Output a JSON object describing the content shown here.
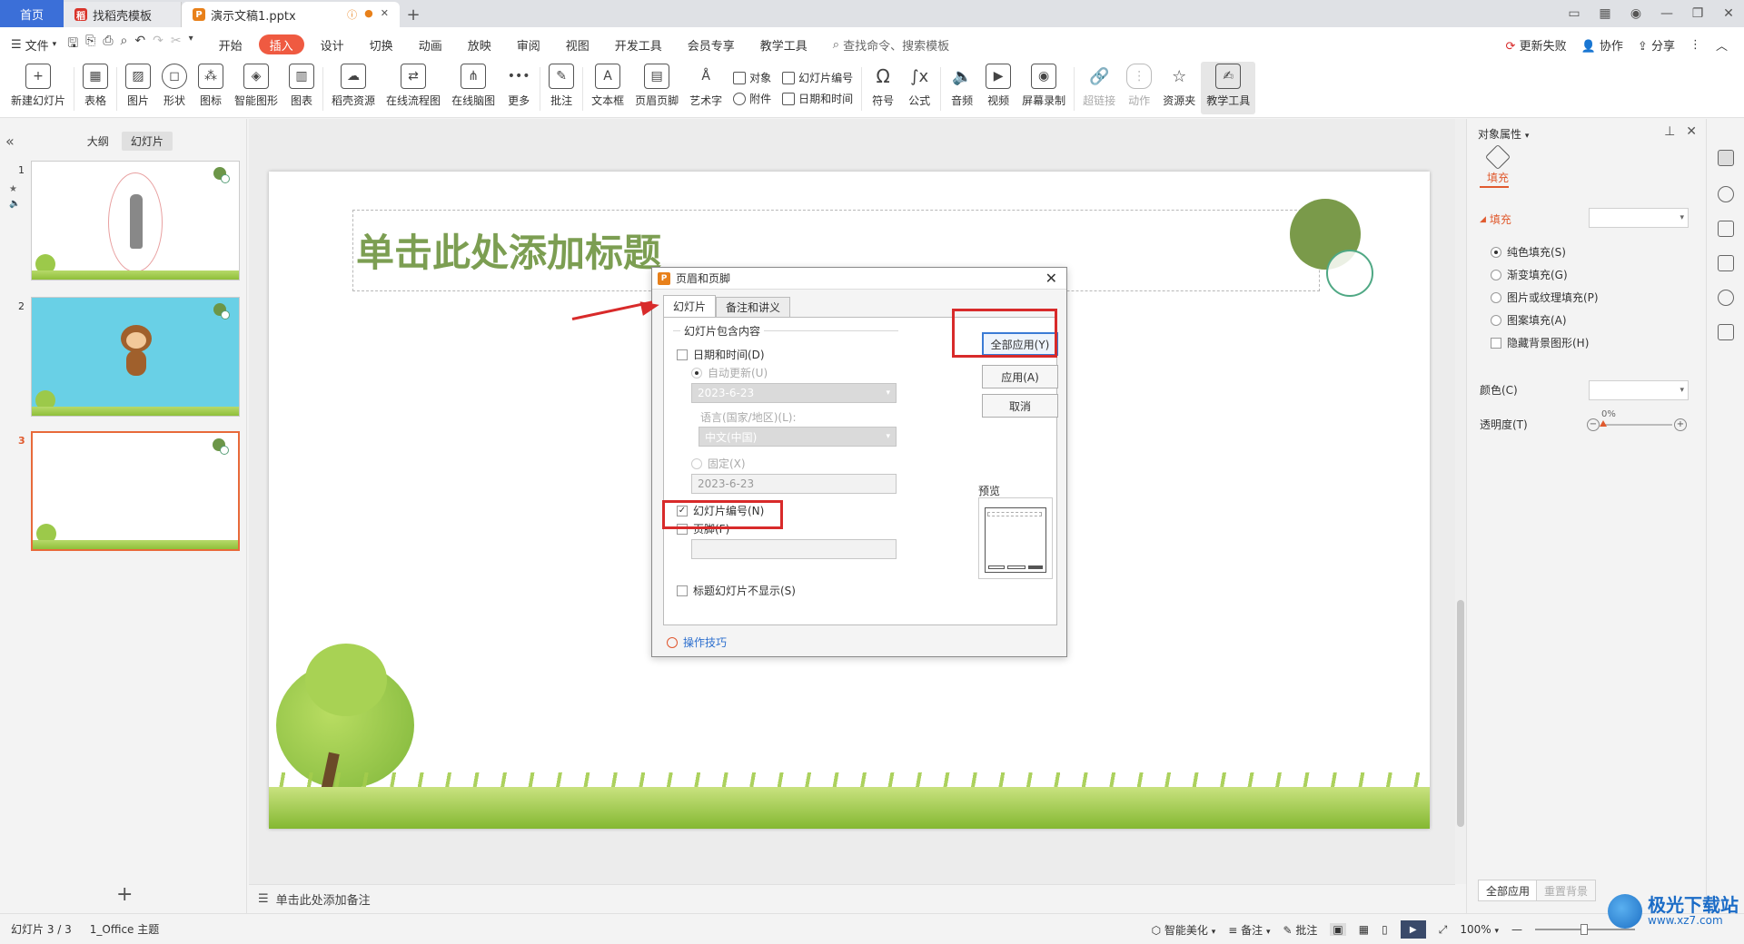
{
  "titlebar": {
    "home_tab": "首页",
    "tab_template": "找稻壳模板",
    "tab_doc": "演示文稿1.pptx",
    "new_tab": "+"
  },
  "menubar": {
    "file": "文件",
    "items": [
      "开始",
      "插入",
      "设计",
      "切换",
      "动画",
      "放映",
      "审阅",
      "视图",
      "开发工具",
      "会员专享",
      "教学工具"
    ],
    "active_item": "插入",
    "search": "查找命令、搜索模板",
    "update_failed": "更新失败",
    "collaborate": "协作",
    "share": "分享"
  },
  "ribbon": {
    "new_slide": "新建幻灯片",
    "table": "表格",
    "picture": "图片",
    "shape": "形状",
    "icon": "图标",
    "smart_graphic": "智能图形",
    "chart": "图表",
    "daoke": "稻壳资源",
    "flowchart": "在线流程图",
    "mindmap": "在线脑图",
    "more": "更多",
    "comment": "批注",
    "textbox": "文本框",
    "header_footer": "页眉页脚",
    "art_text": "艺术字",
    "object": "对象",
    "attachment": "附件",
    "slide_number": "幻灯片编号",
    "datetime": "日期和时间",
    "symbol": "符号",
    "formula": "公式",
    "audio": "音频",
    "video": "视频",
    "screen_record": "屏幕录制",
    "hyperlink": "超链接",
    "action": "动作",
    "resource": "资源夹",
    "teaching": "教学工具"
  },
  "leftpanel": {
    "outline_tab": "大纲",
    "slides_tab": "幻灯片",
    "slide_numbers": [
      "1",
      "2",
      "3"
    ],
    "add": "+"
  },
  "slide": {
    "title_placeholder": "单击此处添加标题"
  },
  "notes": {
    "placeholder": "单击此处添加备注"
  },
  "dialog": {
    "title": "页眉和页脚",
    "tab_slide": "幻灯片",
    "tab_notes": "备注和讲义",
    "group_label": "幻灯片包含内容",
    "date_time": "日期和时间(D)",
    "auto_update": "自动更新(U)",
    "auto_date": "2023-6-23",
    "language_label": "语言(国家/地区)(L):",
    "language": "中文(中国)",
    "fixed": "固定(X)",
    "fixed_date": "2023-6-23",
    "slide_number": "幻灯片编号(N)",
    "slide_number_checked": true,
    "footer": "页脚(F)",
    "footer_value": "",
    "hide_on_title": "标题幻灯片不显示(S)",
    "apply_all": "全部应用(Y)",
    "apply": "应用(A)",
    "cancel": "取消",
    "preview": "预览",
    "help": "操作技巧"
  },
  "rightpanel": {
    "title": "对象属性",
    "fill_tab": "填充",
    "fill_section": "填充",
    "options": [
      "纯色填充(S)",
      "渐变填充(G)",
      "图片或纹理填充(P)",
      "图案填充(A)"
    ],
    "selected_option": "纯色填充(S)",
    "hide_bg": "隐藏背景图形(H)",
    "color_label": "颜色(C)",
    "transparency_label": "透明度(T)",
    "transparency_value": "0%",
    "apply_all": "全部应用",
    "reset_bg": "重置背景"
  },
  "statusbar": {
    "slide_info": "幻灯片 3 / 3",
    "theme": "1_Office 主题",
    "smart_beautify": "智能美化",
    "notes": "备注",
    "comments": "批注",
    "zoom": "100%"
  },
  "watermark": {
    "name": "极光下载站",
    "url": "www.xz7.com"
  },
  "colors": {
    "accent": "#ef5a41",
    "title_green": "#7c9e52",
    "annotation_red": "#d82a2a",
    "home_tab_blue": "#3b6fd8"
  }
}
